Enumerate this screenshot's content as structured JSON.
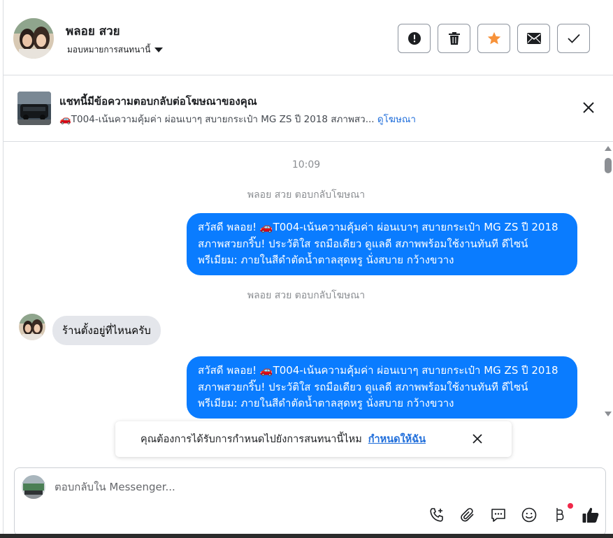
{
  "header": {
    "contact_name": "พลอย สวย",
    "assign_label": "มอบหมายการสนทนานี้"
  },
  "actions": [
    {
      "name": "mark-spam",
      "icon": "alert-icon"
    },
    {
      "name": "delete",
      "icon": "trash-icon"
    },
    {
      "name": "star",
      "icon": "star-icon",
      "color": "#f7923a"
    },
    {
      "name": "mark-unread",
      "icon": "envelope-icon"
    },
    {
      "name": "mark-done",
      "icon": "check-icon"
    }
  ],
  "ad_banner": {
    "title": "แชทนี้มีข้อความตอบกลับต่อโฆษณาของคุณ",
    "subtitle": "🚗T004-เน้นความคุ้มค่า ผ่อนเบาๆ สบายกระเป๋า MG ZS ปี 2018 สภาพสว...",
    "link": "ดูโฆษณา"
  },
  "conversation": {
    "time": "10:09",
    "system_1": "พลอย สวย ตอบกลับโฆษณา",
    "out_1": "สวัสดี พลอย! 🚗T004-เน้นความคุ้มค่า ผ่อนเบาๆ สบายกระเป๋า MG ZS ปี 2018 สภาพสวยกริ๊บ!  ประวัติใส รถมือเดียว ดูแลดี สภาพพร้อมใช้งานทันที ดีไซน์พรีเมียม: ภายในสีดำตัดน้ำตาลสุดหรู นั่งสบาย กว้างขวาง",
    "system_2": "พลอย สวย ตอบกลับโฆษณา",
    "in_1": "ร้านตั้งอยู่ที่ไหนครับ",
    "out_2": "สวัสดี พลอย! 🚗T004-เน้นความคุ้มค่า ผ่อนเบาๆ สบายกระเป๋า MG ZS ปี 2018 สภาพสวยกริ๊บ!  ประวัติใส รถมือเดียว ดูแลดี สภาพพร้อมใช้งานทันที ดีไซน์พรีเมียม: ภายในสีดำตัดน้ำตาลสุดหรู นั่งสบาย กว้างขวาง"
  },
  "toast": {
    "text": "คุณต้องการได้รับการกำหนดไปยังการสนทนานี้ไหม",
    "link": "กำหนดให้ฉัน"
  },
  "composer": {
    "placeholder": "ตอบกลับใน Messenger...",
    "tools": [
      "phone-plus-icon",
      "paperclip-icon",
      "saved-reply-icon",
      "emoji-icon",
      "baht-icon",
      "thumbs-up-icon"
    ]
  },
  "colors": {
    "outgoing_bubble": "#0a7cff",
    "incoming_bubble": "#e4e6eb",
    "link": "#216fdb",
    "star": "#f7923a"
  }
}
